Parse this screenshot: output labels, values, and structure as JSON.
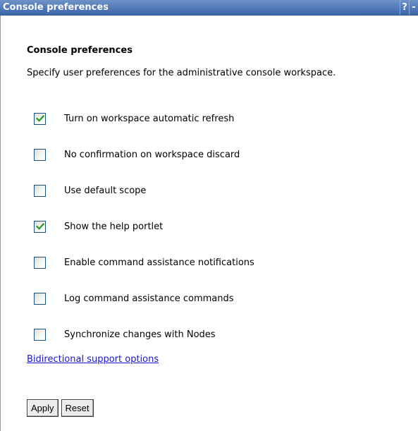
{
  "window": {
    "title": "Console preferences",
    "help_icon": "help-icon",
    "help_glyph": "?",
    "extra_icon": "minimize-icon",
    "extra_glyph": "-"
  },
  "main": {
    "heading": "Console preferences",
    "description": "Specify user preferences for the administrative console workspace.",
    "options": [
      {
        "label": "Turn on workspace automatic refresh",
        "checked": true
      },
      {
        "label": "No confirmation on workspace discard",
        "checked": false
      },
      {
        "label": "Use default scope",
        "checked": false
      },
      {
        "label": "Show the help portlet",
        "checked": true
      },
      {
        "label": "Enable command assistance notifications",
        "checked": false
      },
      {
        "label": "Log command assistance commands",
        "checked": false
      },
      {
        "label": "Synchronize changes with Nodes",
        "checked": false
      }
    ],
    "link_label": "Bidirectional support options",
    "apply_label": "Apply",
    "reset_label": "Reset"
  },
  "colors": {
    "titlebar": "#4f77b6",
    "checkmark": "#1f9d1f",
    "link": "#1515d6"
  }
}
